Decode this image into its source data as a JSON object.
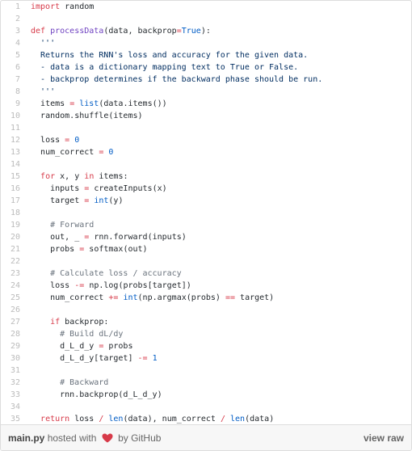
{
  "file": {
    "name": "main.py",
    "hosted_text": "hosted with",
    "by_text": "by GitHub",
    "view_raw": "view raw",
    "heart_color": "#d73a49"
  },
  "code_lines": [
    {
      "n": "1",
      "t": "import random"
    },
    {
      "n": "2",
      "t": ""
    },
    {
      "n": "3",
      "t": "def processData(data, backprop=True):"
    },
    {
      "n": "4",
      "t": "  '''"
    },
    {
      "n": "5",
      "t": "  Returns the RNN's loss and accuracy for the given data."
    },
    {
      "n": "6",
      "t": "  - data is a dictionary mapping text to True or False."
    },
    {
      "n": "7",
      "t": "  - backprop determines if the backward phase should be run."
    },
    {
      "n": "8",
      "t": "  '''"
    },
    {
      "n": "9",
      "t": "  items = list(data.items())"
    },
    {
      "n": "10",
      "t": "  random.shuffle(items)"
    },
    {
      "n": "11",
      "t": ""
    },
    {
      "n": "12",
      "t": "  loss = 0"
    },
    {
      "n": "13",
      "t": "  num_correct = 0"
    },
    {
      "n": "14",
      "t": ""
    },
    {
      "n": "15",
      "t": "  for x, y in items:"
    },
    {
      "n": "16",
      "t": "    inputs = createInputs(x)"
    },
    {
      "n": "17",
      "t": "    target = int(y)"
    },
    {
      "n": "18",
      "t": ""
    },
    {
      "n": "19",
      "t": "    # Forward"
    },
    {
      "n": "20",
      "t": "    out, _ = rnn.forward(inputs)"
    },
    {
      "n": "21",
      "t": "    probs = softmax(out)"
    },
    {
      "n": "22",
      "t": ""
    },
    {
      "n": "23",
      "t": "    # Calculate loss / accuracy"
    },
    {
      "n": "24",
      "t": "    loss -= np.log(probs[target])"
    },
    {
      "n": "25",
      "t": "    num_correct += int(np.argmax(probs) == target)"
    },
    {
      "n": "26",
      "t": ""
    },
    {
      "n": "27",
      "t": "    if backprop:"
    },
    {
      "n": "28",
      "t": "      # Build dL/dy"
    },
    {
      "n": "29",
      "t": "      d_L_d_y = probs"
    },
    {
      "n": "30",
      "t": "      d_L_d_y[target] -= 1"
    },
    {
      "n": "31",
      "t": ""
    },
    {
      "n": "32",
      "t": "      # Backward"
    },
    {
      "n": "33",
      "t": "      rnn.backprop(d_L_d_y)"
    },
    {
      "n": "34",
      "t": ""
    },
    {
      "n": "35",
      "t": "  return loss / len(data), num_correct / len(data)"
    }
  ]
}
